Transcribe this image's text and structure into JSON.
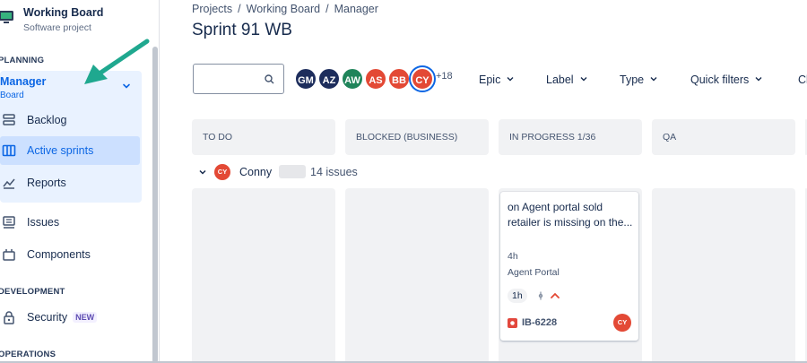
{
  "project": {
    "name": "Working Board",
    "type": "Software project"
  },
  "sidebar": {
    "planning_heading": "PLANNING",
    "board": {
      "title": "Manager",
      "subtitle": "Board"
    },
    "planning_items": [
      {
        "label": "Backlog",
        "icon": "backlog-icon"
      },
      {
        "label": "Active sprints",
        "icon": "columns-icon",
        "active": true
      },
      {
        "label": "Reports",
        "icon": "chart-icon"
      }
    ],
    "items": [
      {
        "label": "Issues",
        "icon": "issues-icon"
      },
      {
        "label": "Components",
        "icon": "components-icon"
      }
    ],
    "development_heading": "DEVELOPMENT",
    "security": {
      "label": "Security",
      "badge": "NEW",
      "icon": "lock-icon"
    },
    "operations_heading": "OPERATIONS"
  },
  "breadcrumb": [
    "Projects",
    "Working Board",
    "Manager"
  ],
  "page_title": "Sprint 91 WB",
  "search": {
    "placeholder": ""
  },
  "avatars": [
    {
      "initials": "GM",
      "color": "#1d2d5c"
    },
    {
      "initials": "AZ",
      "color": "#1d2d5c"
    },
    {
      "initials": "AW",
      "color": "#1f845a"
    },
    {
      "initials": "AS",
      "color": "#e34935"
    },
    {
      "initials": "BB",
      "color": "#e34935"
    },
    {
      "initials": "CY",
      "color": "#e34935",
      "selected": true
    }
  ],
  "avatars_more": "+18",
  "filters": [
    "Epic",
    "Label",
    "Type",
    "Quick filters",
    "Cl"
  ],
  "columns": [
    "TO DO",
    "BLOCKED (BUSINESS)",
    "IN PROGRESS 1/36",
    "QA",
    ""
  ],
  "swimlane": {
    "initials": "CY",
    "name": "Conny",
    "count": "14 issues"
  },
  "card": {
    "title": "on Agent portal sold retailer is missing on the...",
    "time": "4h",
    "epic": "Agent Portal",
    "estimate": "1h",
    "key": "IB-6228",
    "assignee": "CY"
  },
  "colors": {
    "accent": "#0c66e4",
    "annotation_arrow": "#1fa88f",
    "bug": "#e2483d"
  }
}
